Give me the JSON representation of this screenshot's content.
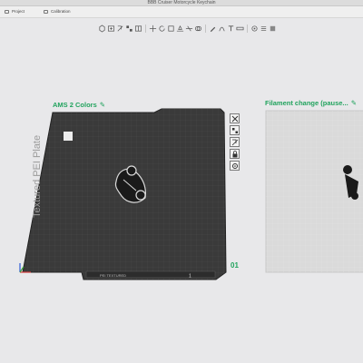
{
  "window": {
    "title": "BBB Cruiser Motorcycle Keychain"
  },
  "tabs": [
    {
      "label": "Project"
    },
    {
      "label": "Calibration"
    }
  ],
  "toolbar": {
    "icons": [
      "add-object-icon",
      "add-plate-icon",
      "auto-orient-icon",
      "arrange-icon",
      "split-icon",
      "move-icon",
      "rotate-icon",
      "scale-icon",
      "lay-on-face-icon",
      "cut-icon",
      "boolean-icon",
      "support-paint-icon",
      "seam-paint-icon",
      "text-icon",
      "measure-icon",
      "color-paint-icon",
      "variable-layer-icon",
      "view-icon"
    ]
  },
  "plates": [
    {
      "label": "AMS 2 Colors",
      "plate_text": "Textured PEI Plate",
      "footer": "PEI TEXTURED",
      "footer_num": "1",
      "number": "01"
    },
    {
      "label": "Filament change (pause..."
    }
  ],
  "plate_tools": [
    "close-icon",
    "arrange-plate-icon",
    "orient-plate-icon",
    "lock-plate-icon",
    "plate-settings-icon"
  ],
  "colors": {
    "accent": "#22a35e",
    "plate": "#3a3a3a",
    "grid": "#4b4b4b",
    "plate2": "#dcdcdc"
  }
}
